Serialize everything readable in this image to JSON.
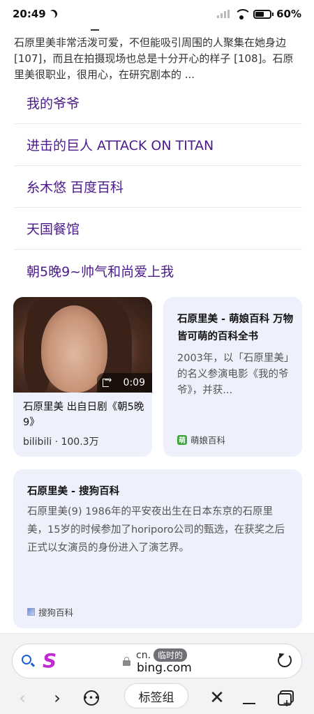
{
  "status_bar": {
    "time": "20:49",
    "battery_text": "60%",
    "battery_level": 0.6,
    "icons": [
      "moon-icon",
      "signal-icon",
      "wifi-icon",
      "battery-icon"
    ]
  },
  "snippet": {
    "text": "石原里美非常活泼可爱，不但能吸引周围的人聚集在她身边 [107]，而且在拍摄现场也总是十分开心的样子 [108]。石原里美很职业，很用心，在研究剧本的 ..."
  },
  "related_links": [
    {
      "label": "我的爷爷"
    },
    {
      "label": "进击的巨人 ATTACK ON TITAN"
    },
    {
      "label": "糸木悠 百度百科"
    },
    {
      "label": "天国餐馆"
    },
    {
      "label": "朝5晚9~帅气和尚爱上我"
    }
  ],
  "video_card": {
    "duration": "0:09",
    "title": "石原里美 出自日剧《朝5晚9》",
    "source": "bilibili",
    "separator": "·",
    "views": "100.3万"
  },
  "moe_card": {
    "title": "石原里美 - 萌娘百科 万物皆可萌的百科全书",
    "description": "2003年，以「石原里美」的名义参演电影《我的爷爷》，并获...",
    "source_logo": "萌",
    "source": "萌娘百科"
  },
  "sogou_card": {
    "title": "石原里美 - 搜狗百科",
    "description": "石原里美(9) 1986年的平安夜出生在日本东京的石原里美，15岁的时候参加了horiporo公司的甄选，在获奖之后正式以女演员的身份进入了演艺界。",
    "source": "搜狗百科"
  },
  "address_bar": {
    "url_prefix": "cn.",
    "temp_badge": "临时的",
    "url_main": "bing.com",
    "brand_letter": "S"
  },
  "bottom_nav": {
    "back": "‹",
    "forward": "›",
    "more": "•••",
    "tabs_label": "标签组",
    "close": "✕",
    "newtab_plus": "+"
  },
  "colors": {
    "link": "#4b1a8c",
    "card_bg": "#eef0fb",
    "brand": "#c02ad0",
    "search_blue": "#1a5fd1"
  }
}
